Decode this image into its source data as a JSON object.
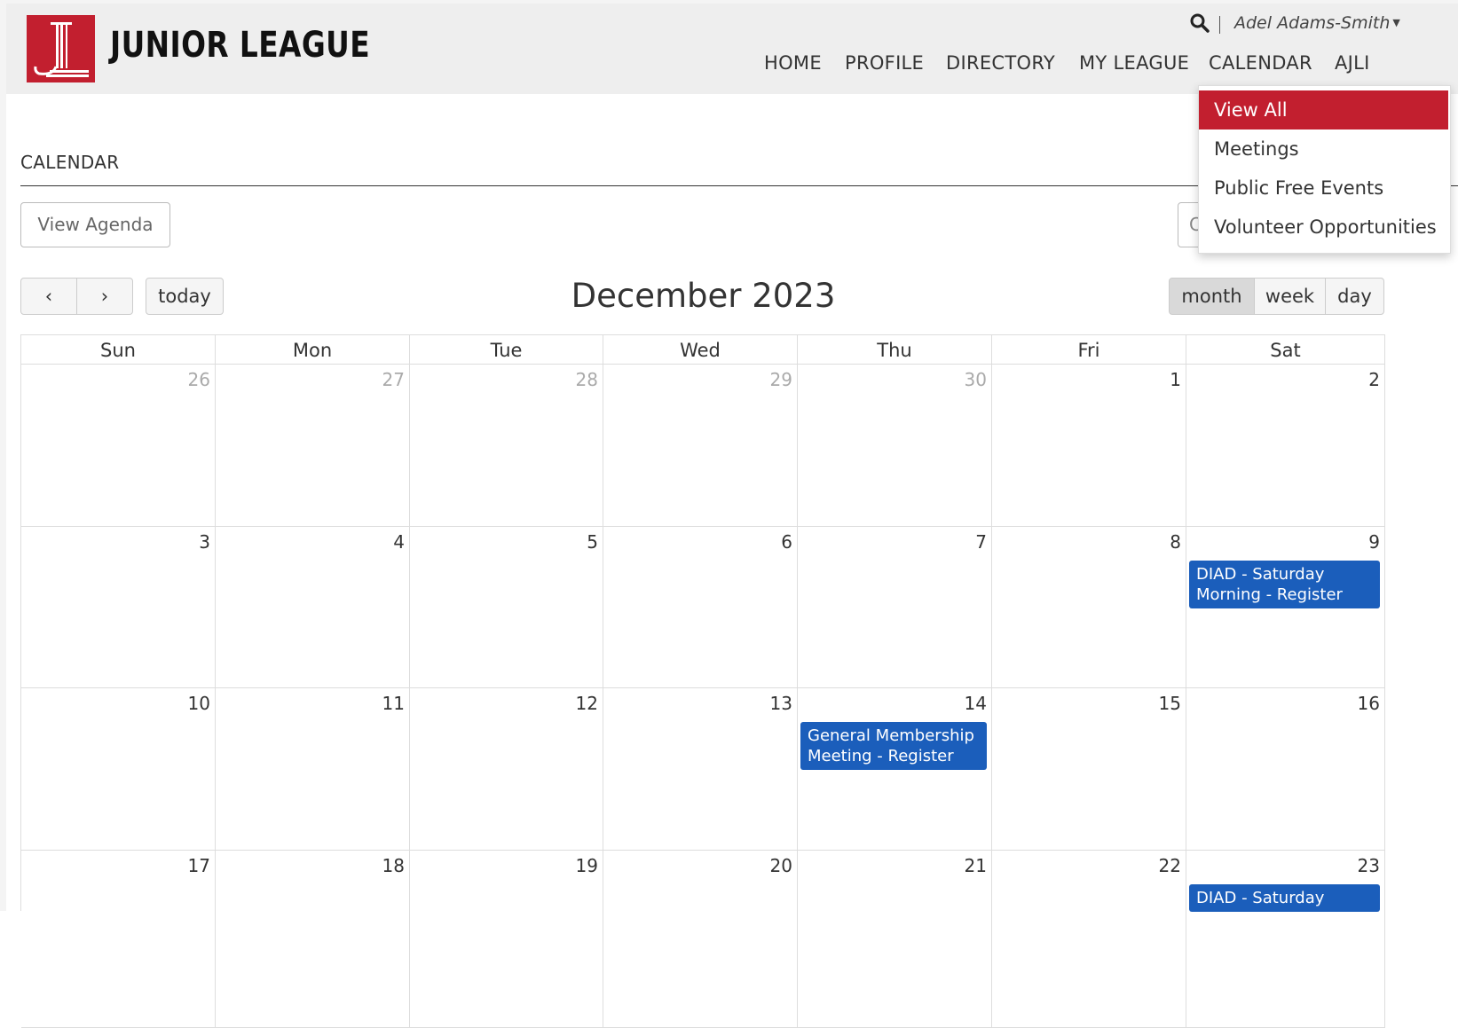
{
  "brand": {
    "name": "JUNIOR LEAGUE"
  },
  "header": {
    "user_name": "Adel Adams-Smith",
    "nav": [
      {
        "label": "HOME"
      },
      {
        "label": "PROFILE"
      },
      {
        "label": "DIRECTORY"
      },
      {
        "label": "MY LEAGUE"
      },
      {
        "label": "CALENDAR"
      },
      {
        "label": "AJLI"
      }
    ]
  },
  "dropdown": {
    "items": [
      {
        "label": "View All",
        "active": true
      },
      {
        "label": "Meetings"
      },
      {
        "label": "Public Free Events"
      },
      {
        "label": "Volunteer Opportunities"
      }
    ]
  },
  "page": {
    "title": "CALENDAR",
    "view_agenda": "View Agenda",
    "partial_button": "C"
  },
  "calendar": {
    "title": "December 2023",
    "today": "today",
    "prev": "‹",
    "next": "›",
    "views": [
      "month",
      "week",
      "day"
    ],
    "active_view": "month",
    "days_of_week": [
      "Sun",
      "Mon",
      "Tue",
      "Wed",
      "Thu",
      "Fri",
      "Sat"
    ],
    "weeks": [
      [
        {
          "d": "26",
          "other": true
        },
        {
          "d": "27",
          "other": true
        },
        {
          "d": "28",
          "other": true
        },
        {
          "d": "29",
          "other": true
        },
        {
          "d": "30",
          "other": true
        },
        {
          "d": "1"
        },
        {
          "d": "2"
        }
      ],
      [
        {
          "d": "3"
        },
        {
          "d": "4"
        },
        {
          "d": "5"
        },
        {
          "d": "6"
        },
        {
          "d": "7"
        },
        {
          "d": "8"
        },
        {
          "d": "9",
          "event": "DIAD - Saturday Morning - Register"
        }
      ],
      [
        {
          "d": "10"
        },
        {
          "d": "11"
        },
        {
          "d": "12"
        },
        {
          "d": "13"
        },
        {
          "d": "14",
          "event": "General Membership Meeting - Register"
        },
        {
          "d": "15"
        },
        {
          "d": "16"
        }
      ],
      [
        {
          "d": "17"
        },
        {
          "d": "18"
        },
        {
          "d": "19"
        },
        {
          "d": "20"
        },
        {
          "d": "21"
        },
        {
          "d": "22"
        },
        {
          "d": "23",
          "event": "DIAD - Saturday"
        }
      ]
    ]
  },
  "colors": {
    "brand_red": "#c21f2f",
    "event_blue": "#1b5ebb"
  }
}
